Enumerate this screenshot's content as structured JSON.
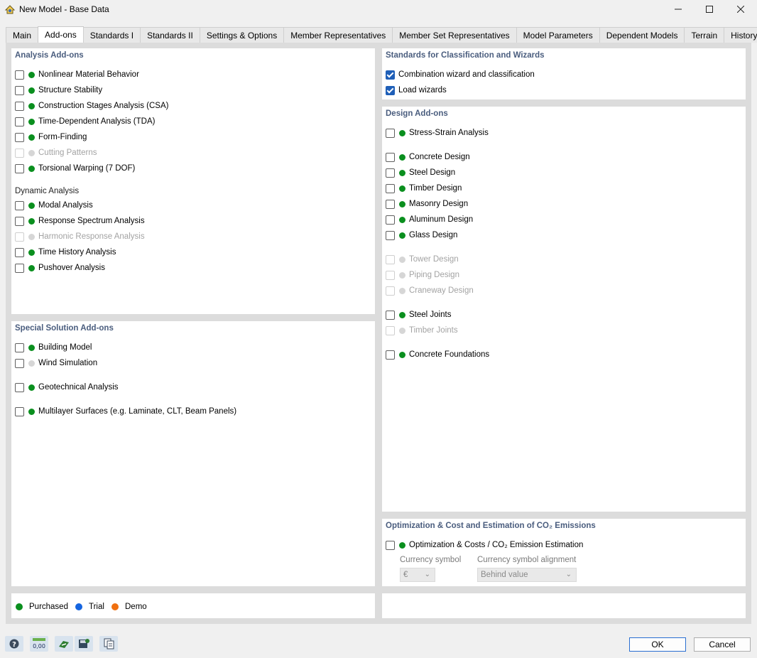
{
  "window": {
    "title": "New Model - Base Data",
    "icon": "app-icon",
    "controls": [
      "minimize-icon",
      "maximize-icon",
      "close-icon"
    ]
  },
  "tabs": [
    {
      "label": "Main",
      "active": false
    },
    {
      "label": "Add-ons",
      "active": true
    },
    {
      "label": "Standards I",
      "active": false
    },
    {
      "label": "Standards II",
      "active": false
    },
    {
      "label": "Settings & Options",
      "active": false
    },
    {
      "label": "Member Representatives",
      "active": false
    },
    {
      "label": "Member Set Representatives",
      "active": false
    },
    {
      "label": "Model Parameters",
      "active": false
    },
    {
      "label": "Dependent Models",
      "active": false
    },
    {
      "label": "Terrain",
      "active": false
    },
    {
      "label": "History",
      "active": false
    }
  ],
  "analysis": {
    "title": "Analysis Add-ons",
    "items": [
      {
        "label": "Nonlinear Material Behavior",
        "checked": false,
        "status": "purchased",
        "enabled": true
      },
      {
        "label": "Structure Stability",
        "checked": false,
        "status": "purchased",
        "enabled": true
      },
      {
        "label": "Construction Stages Analysis (CSA)",
        "checked": false,
        "status": "purchased",
        "enabled": true
      },
      {
        "label": "Time-Dependent Analysis (TDA)",
        "checked": false,
        "status": "purchased",
        "enabled": true
      },
      {
        "label": "Form-Finding",
        "checked": false,
        "status": "purchased",
        "enabled": true
      },
      {
        "label": "Cutting Patterns",
        "checked": false,
        "status": "unavailable",
        "enabled": false
      },
      {
        "label": "Torsional Warping (7 DOF)",
        "checked": false,
        "status": "purchased",
        "enabled": true
      }
    ],
    "dynamic_title": "Dynamic Analysis",
    "dynamic_items": [
      {
        "label": "Modal Analysis",
        "checked": false,
        "status": "purchased",
        "enabled": true
      },
      {
        "label": "Response Spectrum Analysis",
        "checked": false,
        "status": "purchased",
        "enabled": true
      },
      {
        "label": "Harmonic Response Analysis",
        "checked": false,
        "status": "unavailable",
        "enabled": false
      },
      {
        "label": "Time History Analysis",
        "checked": false,
        "status": "purchased",
        "enabled": true
      },
      {
        "label": "Pushover Analysis",
        "checked": false,
        "status": "purchased",
        "enabled": true
      }
    ]
  },
  "special": {
    "title": "Special Solution Add-ons",
    "items": [
      {
        "label": "Building Model",
        "checked": false,
        "status": "purchased",
        "enabled": true
      },
      {
        "label": "Wind Simulation",
        "checked": false,
        "status": "unavailable",
        "enabled": true
      },
      {
        "label": "Geotechnical Analysis",
        "checked": false,
        "status": "purchased",
        "enabled": true
      },
      {
        "label": "Multilayer Surfaces (e.g. Laminate, CLT, Beam Panels)",
        "checked": false,
        "status": "purchased",
        "enabled": true
      }
    ]
  },
  "standards": {
    "title": "Standards for Classification and Wizards",
    "items": [
      {
        "label": "Combination wizard and classification",
        "checked": true
      },
      {
        "label": "Load wizards",
        "checked": true
      }
    ]
  },
  "design": {
    "title": "Design Add-ons",
    "items": [
      {
        "label": "Stress-Strain Analysis",
        "checked": false,
        "status": "purchased",
        "enabled": true
      },
      {
        "label": "Concrete Design",
        "checked": false,
        "status": "purchased",
        "enabled": true
      },
      {
        "label": "Steel Design",
        "checked": false,
        "status": "purchased",
        "enabled": true
      },
      {
        "label": "Timber Design",
        "checked": false,
        "status": "purchased",
        "enabled": true
      },
      {
        "label": "Masonry Design",
        "checked": false,
        "status": "purchased",
        "enabled": true
      },
      {
        "label": "Aluminum Design",
        "checked": false,
        "status": "purchased",
        "enabled": true
      },
      {
        "label": "Glass Design",
        "checked": false,
        "status": "purchased",
        "enabled": true
      },
      {
        "label": "Tower Design",
        "checked": false,
        "status": "unavailable",
        "enabled": false
      },
      {
        "label": "Piping Design",
        "checked": false,
        "status": "unavailable",
        "enabled": false
      },
      {
        "label": "Craneway Design",
        "checked": false,
        "status": "unavailable",
        "enabled": false
      },
      {
        "label": "Steel Joints",
        "checked": false,
        "status": "purchased",
        "enabled": true
      },
      {
        "label": "Timber Joints",
        "checked": false,
        "status": "unavailable",
        "enabled": false
      },
      {
        "label": "Concrete Foundations",
        "checked": false,
        "status": "purchased",
        "enabled": true
      }
    ]
  },
  "optimization": {
    "title": "Optimization & Cost and Estimation of CO₂ Emissions",
    "item": {
      "label": "Optimization & Costs / CO₂ Emission Estimation",
      "checked": false,
      "status": "purchased",
      "enabled": true
    },
    "currency_symbol_label": "Currency symbol",
    "currency_symbol_value": "€",
    "alignment_label": "Currency symbol alignment",
    "alignment_value": "Behind value"
  },
  "legend": [
    {
      "label": "Purchased",
      "color": "#0a8f1e"
    },
    {
      "label": "Trial",
      "color": "#1565e0"
    },
    {
      "label": "Demo",
      "color": "#f07010"
    }
  ],
  "colors": {
    "purchased": "#0a8f1e",
    "unavailable": "#d6d6d6",
    "section_title": "#4a5d7e",
    "checkbox_checked": "#1f5fb8"
  },
  "toolbar": {
    "icons": [
      "help-icon",
      "units-icon",
      "model-settings-icon",
      "save-defaults-icon",
      "copy-settings-icon"
    ],
    "units_text": "0,00"
  },
  "buttons": {
    "ok": "OK",
    "cancel": "Cancel"
  }
}
